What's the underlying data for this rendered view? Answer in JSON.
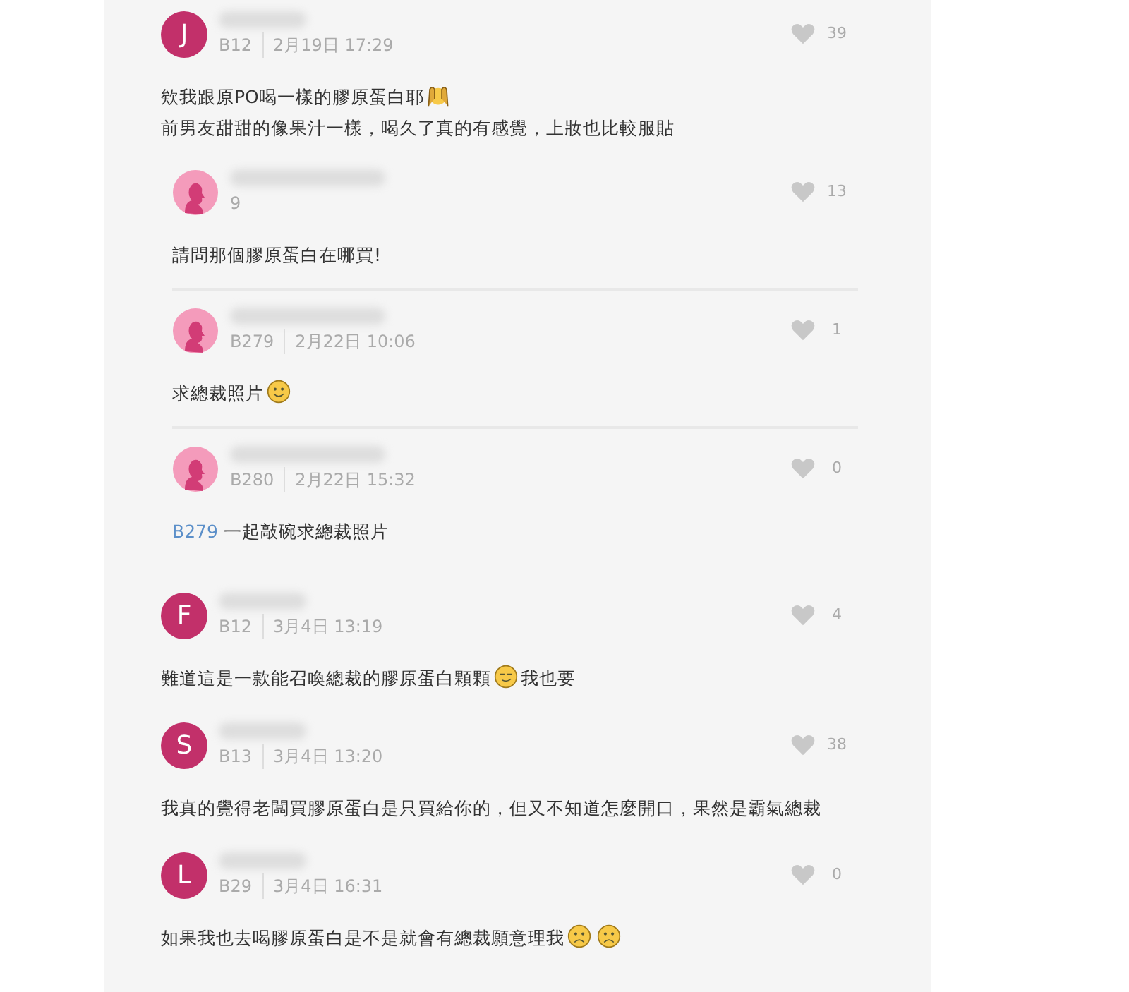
{
  "comments": [
    {
      "avatar": {
        "kind": "letter",
        "letter": "J"
      },
      "meta": [
        "B12",
        "2月19日 17:29"
      ],
      "likes": "39",
      "replies": [
        {
          "avatar": {
            "kind": "silhouette"
          },
          "meta": [
            "9"
          ],
          "likes": "13",
          "body": [
            [
              {
                "kind": "text",
                "text": "請問那個膠原蛋白在哪買!"
              }
            ]
          ]
        },
        {
          "avatar": {
            "kind": "silhouette"
          },
          "meta": [
            "B279",
            "2月22日 10:06"
          ],
          "likes": "1",
          "body": [
            [
              {
                "kind": "text",
                "text": "求總裁照片"
              },
              {
                "kind": "smile"
              }
            ]
          ]
        },
        {
          "avatar": {
            "kind": "silhouette"
          },
          "meta": [
            "B280",
            "2月22日 15:32"
          ],
          "likes": "0",
          "body": [
            [
              {
                "kind": "mention",
                "text": "B279"
              },
              {
                "kind": "text",
                "text": "一起敲碗求總裁照片"
              }
            ]
          ]
        }
      ],
      "body": [
        [
          {
            "kind": "text",
            "text": "欸我跟原PO喝一樣的膠原蛋白耶"
          },
          {
            "kind": "hands"
          }
        ],
        [
          {
            "kind": "text",
            "text": "前男友甜甜的像果汁一樣，喝久了真的有感覺，上妝也比較服貼"
          }
        ]
      ]
    },
    {
      "avatar": {
        "kind": "letter",
        "letter": "F"
      },
      "meta": [
        "B12",
        "3月4日 13:19"
      ],
      "likes": "4",
      "body": [
        [
          {
            "kind": "text",
            "text": "難道這是一款能召喚總裁的膠原蛋白顆顆"
          },
          {
            "kind": "smirk"
          },
          {
            "kind": "text",
            "text": "我也要"
          }
        ]
      ]
    },
    {
      "avatar": {
        "kind": "letter",
        "letter": "S"
      },
      "meta": [
        "B13",
        "3月4日 13:20"
      ],
      "likes": "38",
      "body": [
        [
          {
            "kind": "text",
            "text": "我真的覺得老闆買膠原蛋白是只買給你的，但又不知道怎麼開口，果然是霸氣總裁"
          }
        ]
      ]
    },
    {
      "avatar": {
        "kind": "letter",
        "letter": "L"
      },
      "meta": [
        "B29",
        "3月4日 16:31"
      ],
      "likes": "0",
      "body": [
        [
          {
            "kind": "text",
            "text": "如果我也去喝膠原蛋白是不是就會有總裁願意理我"
          },
          {
            "kind": "sad"
          },
          {
            "kind": "sad"
          }
        ]
      ]
    }
  ]
}
